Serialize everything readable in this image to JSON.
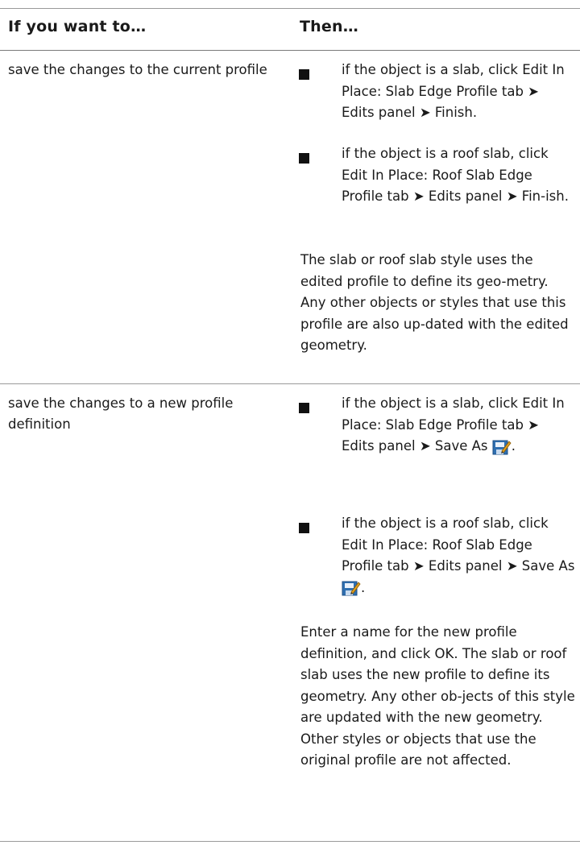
{
  "table": {
    "col_when": "If you want to…",
    "col_then": "Then…",
    "rows": [
      {
        "condition": "save the changes to the current profile",
        "steps": [
          {
            "before": "if the object is a slab, click Edit In Place: Slab Edge Profile tab ➤ Edits panel ➤ Finish.",
            "icon": "",
            "after": ""
          },
          {
            "before": "if the object is a roof slab, click Edit In Place: Roof Slab Edge Profile tab ➤ Edits panel ➤ Fin-ish.",
            "icon": "",
            "after": ""
          }
        ],
        "note": "The slab or roof slab style uses the edited profile to define its geo-metry. Any other objects or styles that use this profile are also up-dated with the edited geometry."
      },
      {
        "condition": "save the changes to a new profile definition",
        "steps": [
          {
            "before": "if the object is a slab, click Edit In Place: Slab Edge Profile tab ➤ Edits panel ➤ Save As",
            "icon": "save-as-icon",
            "after": "."
          },
          {
            "before": "if the object is a roof slab, click Edit In Place: Roof Slab Edge Profile tab ➤ Edits panel ➤ Save As",
            "icon": "save-as-icon",
            "after": "."
          }
        ],
        "note": "Enter a name for the new profile definition, and click OK. The slab or roof slab uses the new profile to define its geometry. Any other ob-jects of this style are updated with the new geometry. Other styles or objects that use the original profile are not affected."
      }
    ]
  },
  "colors": {
    "rule": "#9a9a9a",
    "icon_blue": "#2f6fb0",
    "icon_pencil": "#e0a020"
  }
}
